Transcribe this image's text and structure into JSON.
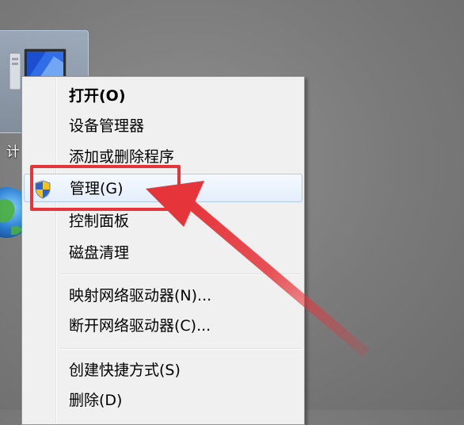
{
  "desktop": {
    "computer_icon_label": "计",
    "network_icon_label": ""
  },
  "context_menu": {
    "items": [
      {
        "label": "打开(O)"
      },
      {
        "label": "设备管理器"
      },
      {
        "label": "添加或删除程序"
      },
      {
        "label": "管理(G)"
      },
      {
        "label": "控制面板"
      },
      {
        "label": "磁盘清理"
      },
      {
        "label": "映射网络驱动器(N)..."
      },
      {
        "label": "断开网络驱动器(C)..."
      },
      {
        "label": "创建快捷方式(S)"
      },
      {
        "label": "删除(D)"
      }
    ]
  },
  "annotation": {
    "color": "#e5343a"
  }
}
